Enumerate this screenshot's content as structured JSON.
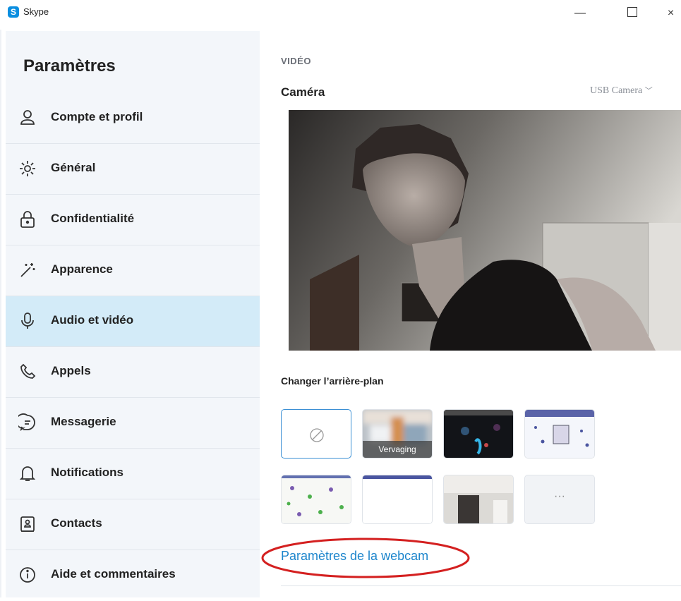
{
  "window": {
    "title": "Skype",
    "controls": {
      "minimize": "—",
      "maximize": "",
      "close": "×"
    }
  },
  "sidebar": {
    "title": "Paramètres",
    "items": [
      {
        "label": "Compte et profil",
        "icon": "person-icon",
        "active": false
      },
      {
        "label": "Général",
        "icon": "gear-icon",
        "active": false
      },
      {
        "label": "Confidentialité",
        "icon": "lock-icon",
        "active": false
      },
      {
        "label": "Apparence",
        "icon": "magic-wand-icon",
        "active": false
      },
      {
        "label": "Audio et vidéo",
        "icon": "microphone-icon",
        "active": true
      },
      {
        "label": "Appels",
        "icon": "phone-icon",
        "active": false
      },
      {
        "label": "Messagerie",
        "icon": "chat-icon",
        "active": false
      },
      {
        "label": "Notifications",
        "icon": "bell-icon",
        "active": false
      },
      {
        "label": "Contacts",
        "icon": "contacts-icon",
        "active": false
      },
      {
        "label": "Aide et commentaires",
        "icon": "info-icon",
        "active": false
      }
    ]
  },
  "main": {
    "section_label": "VIDÉO",
    "camera_label": "Caméra",
    "camera_select": "USB Camera",
    "background_label": "Changer l’arrière-plan",
    "backgrounds": [
      {
        "name": "none",
        "caption": "",
        "selected": true
      },
      {
        "name": "blur",
        "caption": "Vervaging",
        "selected": false
      },
      {
        "name": "dark-aquarium",
        "caption": "",
        "selected": false
      },
      {
        "name": "snowflakes-pattern",
        "caption": "",
        "selected": false
      },
      {
        "name": "trees-pattern",
        "caption": "",
        "selected": false
      },
      {
        "name": "plain-white",
        "caption": "",
        "selected": false
      },
      {
        "name": "room-photo",
        "caption": "",
        "selected": false
      },
      {
        "name": "more",
        "caption": "···",
        "selected": false
      }
    ],
    "webcam_settings_link": "Paramètres de la webcam"
  },
  "colors": {
    "accent": "#1c85cc",
    "sidebar_bg": "#f3f6fa",
    "sidebar_active": "#d3ebf8",
    "annotation": "#d42020"
  }
}
